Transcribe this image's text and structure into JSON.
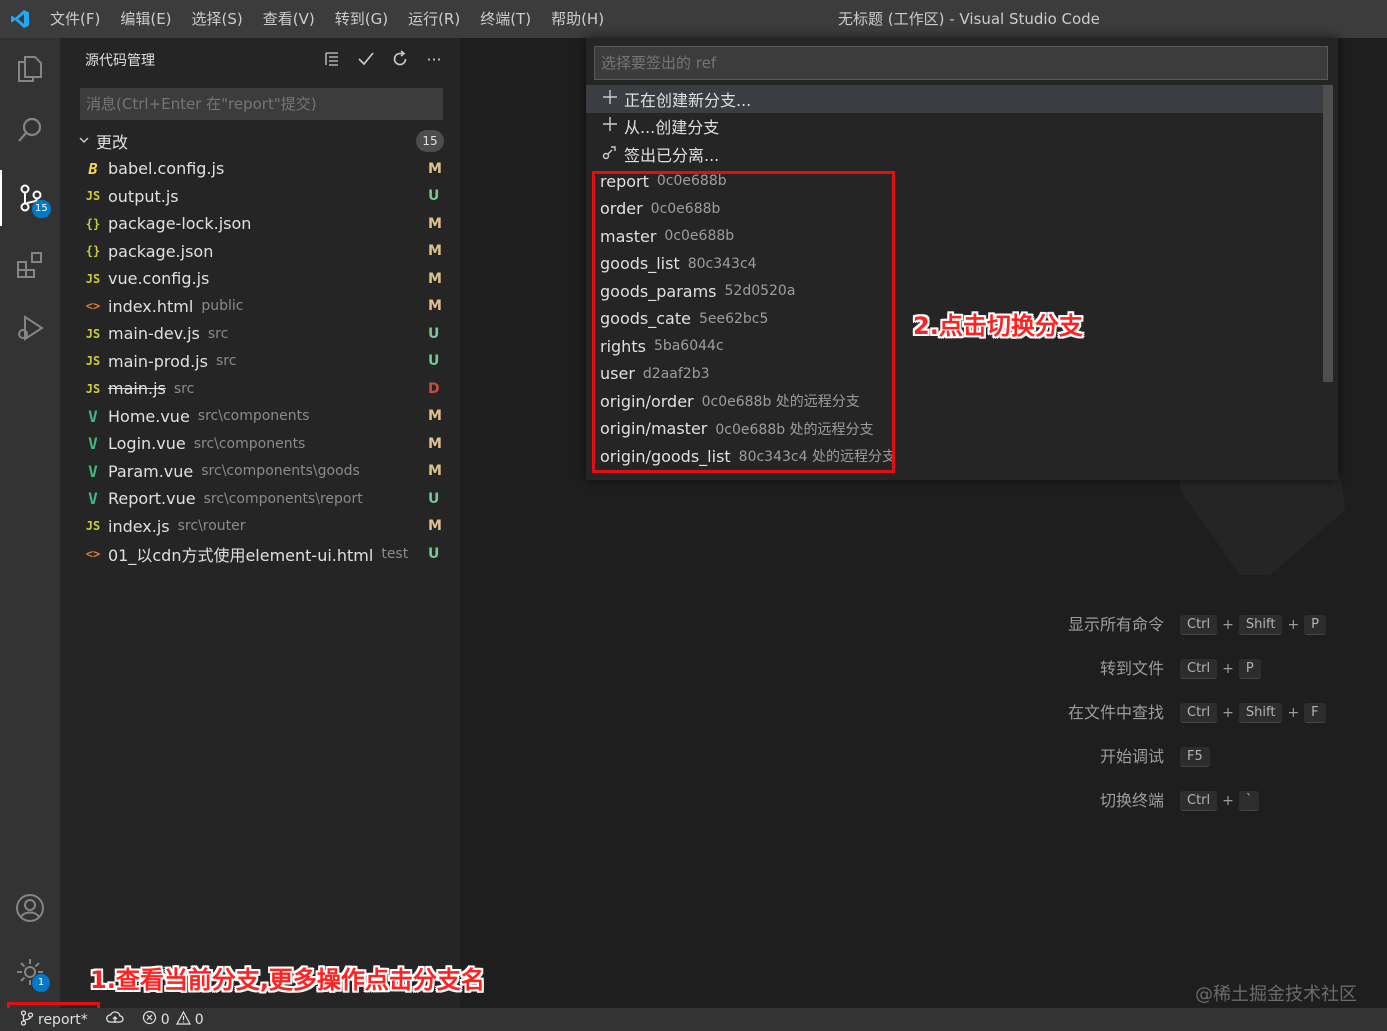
{
  "titlebar": {
    "menu": [
      "文件(F)",
      "编辑(E)",
      "选择(S)",
      "查看(V)",
      "转到(G)",
      "运行(R)",
      "终端(T)",
      "帮助(H)"
    ],
    "title": "无标题 (工作区) - Visual Studio Code"
  },
  "activitybar": {
    "items": [
      "explorer-icon",
      "search-icon",
      "source-control-icon",
      "extensions-icon",
      "run-debug-icon"
    ],
    "scm_badge": "15",
    "settings_badge": "1"
  },
  "sidebar": {
    "title": "源代码管理",
    "commit_placeholder": "消息(Ctrl+Enter 在\"report\"提交)",
    "changes_label": "更改",
    "changes_count": "15",
    "files": [
      {
        "icon": "babel",
        "name": "babel.config.js",
        "path": "",
        "status": "M"
      },
      {
        "icon": "js",
        "name": "output.js",
        "path": "",
        "status": "U"
      },
      {
        "icon": "json",
        "name": "package-lock.json",
        "path": "",
        "status": "M"
      },
      {
        "icon": "json",
        "name": "package.json",
        "path": "",
        "status": "M"
      },
      {
        "icon": "js",
        "name": "vue.config.js",
        "path": "",
        "status": "M"
      },
      {
        "icon": "html",
        "name": "index.html",
        "path": "public",
        "status": "M"
      },
      {
        "icon": "js",
        "name": "main-dev.js",
        "path": "src",
        "status": "U"
      },
      {
        "icon": "js",
        "name": "main-prod.js",
        "path": "src",
        "status": "U"
      },
      {
        "icon": "js",
        "name": "main.js",
        "path": "src",
        "status": "D"
      },
      {
        "icon": "vue",
        "name": "Home.vue",
        "path": "src\\components",
        "status": "M"
      },
      {
        "icon": "vue",
        "name": "Login.vue",
        "path": "src\\components",
        "status": "M"
      },
      {
        "icon": "vue",
        "name": "Param.vue",
        "path": "src\\components\\goods",
        "status": "M"
      },
      {
        "icon": "vue",
        "name": "Report.vue",
        "path": "src\\components\\report",
        "status": "U"
      },
      {
        "icon": "js",
        "name": "index.js",
        "path": "src\\router",
        "status": "M"
      },
      {
        "icon": "html",
        "name": "01_以cdn方式使用element-ui.html",
        "path": "test",
        "status": "U"
      }
    ]
  },
  "quickpick": {
    "placeholder": "选择要签出的 ref",
    "actions": [
      {
        "icon": "plus-icon",
        "label": "正在创建新分支..."
      },
      {
        "icon": "plus-icon",
        "label": "从...创建分支"
      },
      {
        "icon": "detach-icon",
        "label": "签出已分离..."
      }
    ],
    "refs": [
      {
        "name": "report",
        "desc": "0c0e688b"
      },
      {
        "name": "order",
        "desc": "0c0e688b"
      },
      {
        "name": "master",
        "desc": "0c0e688b"
      },
      {
        "name": "goods_list",
        "desc": "80c343c4"
      },
      {
        "name": "goods_params",
        "desc": "52d0520a"
      },
      {
        "name": "goods_cate",
        "desc": "5ee62bc5"
      },
      {
        "name": "rights",
        "desc": "5ba6044c"
      },
      {
        "name": "user",
        "desc": "d2aaf2b3"
      },
      {
        "name": "origin/order",
        "desc": "0c0e688b 处的远程分支"
      },
      {
        "name": "origin/master",
        "desc": "0c0e688b 处的远程分支"
      },
      {
        "name": "origin/goods_list",
        "desc": "80c343c4 处的远程分支"
      }
    ]
  },
  "shortcuts": [
    {
      "label": "显示所有命令",
      "keys": [
        "Ctrl",
        "Shift",
        "P"
      ]
    },
    {
      "label": "转到文件",
      "keys": [
        "Ctrl",
        "P"
      ]
    },
    {
      "label": "在文件中查找",
      "keys": [
        "Ctrl",
        "Shift",
        "F"
      ]
    },
    {
      "label": "开始调试",
      "keys": [
        "F5"
      ]
    },
    {
      "label": "切换终端",
      "keys": [
        "Ctrl",
        "`"
      ]
    }
  ],
  "annotations": {
    "note1": "1.查看当前分支,更多操作点击分支名",
    "note2": "2.点击切换分支"
  },
  "statusbar": {
    "branch": "report*",
    "errors": "0",
    "warnings": "0"
  },
  "watermark": "@稀土掘金技术社区",
  "colors": {
    "accent": "#007acc",
    "modified": "#e2c08d",
    "untracked": "#73c991",
    "deleted": "#c74e39",
    "annotation": "#e01010"
  }
}
